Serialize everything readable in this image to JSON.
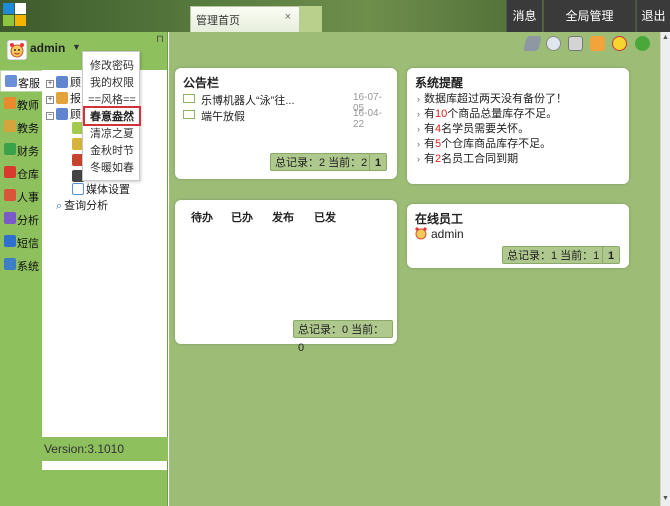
{
  "header": {
    "tab_label": "管理首页",
    "tab_close": "×",
    "buttons": [
      "消息",
      "全局管理",
      "退出"
    ]
  },
  "user": {
    "name": "admin",
    "caret": "▼",
    "pin": "⊓"
  },
  "sidebar": {
    "nav": [
      "客服",
      "教师",
      "教务",
      "财务",
      "仓库",
      "人事",
      "分析",
      "短信",
      "系统"
    ],
    "tree": [
      {
        "prefix": "⊞",
        "label": "顾"
      },
      {
        "prefix": "⊞",
        "label": "报"
      },
      {
        "prefix": "⊟",
        "label": "顾"
      },
      {
        "prefix": "",
        "label": "媒体设置"
      },
      {
        "prefix": "",
        "label": "查询分析"
      }
    ],
    "version": "Version:3.1010"
  },
  "user_menu": {
    "items": [
      "修改密码",
      "我的权限",
      "==风格==",
      "春意盎然",
      "清凉之夏",
      "金秋时节",
      "冬暖如春"
    ],
    "selected": "春意盎然"
  },
  "notice_board": {
    "title": "公告栏",
    "items": [
      {
        "title": "乐博机器人“泳”往...",
        "date": "16-07-05"
      },
      {
        "title": "端午放假",
        "date": "16-04-22"
      }
    ],
    "summary": "总记录：2 当前：2",
    "page": "1"
  },
  "system_alerts": {
    "title": "系统提醒",
    "items": [
      {
        "pre": "数据库超过两天没有备份了！",
        "num": "",
        "post": ""
      },
      {
        "pre": "有",
        "num": "10",
        "post": "个商品总量库存不足。"
      },
      {
        "pre": "有",
        "num": "4",
        "post": "名学员需要关怀。"
      },
      {
        "pre": "有",
        "num": "5",
        "post": "个仓库商品库存不足。"
      },
      {
        "pre": "有",
        "num": "2",
        "post": "名员工合同到期"
      }
    ]
  },
  "tasks": {
    "tabs": [
      "待办",
      "已办",
      "发布",
      "已发"
    ],
    "summary": "总记录：0 当前：0"
  },
  "online_staff": {
    "title": "在线员工",
    "user": "admin",
    "summary": "总记录：1 当前：1",
    "page": "1"
  },
  "colors": {
    "accent_green": "#8ec05e",
    "main_bg": "#9dbd77",
    "highlight_red": "#e02020"
  },
  "toolbar_icons": [
    "disk-icon",
    "globe-icon",
    "printer-icon",
    "wheat-icon",
    "smiley-icon",
    "help-icon"
  ]
}
